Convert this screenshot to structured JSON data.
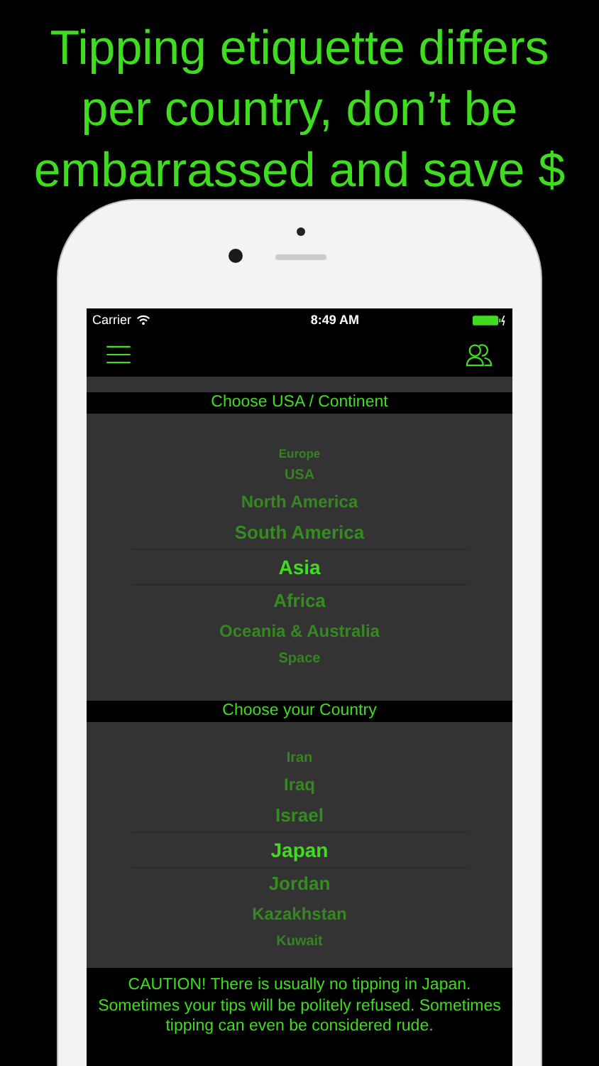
{
  "headline": "Tipping etiquette differs per country, don’t be embarrassed and save $",
  "status_bar": {
    "carrier": "Carrier",
    "time": "8:49 AM"
  },
  "continent_picker": {
    "title": "Choose USA / Continent",
    "items": [
      {
        "label": "Europe",
        "selected": false
      },
      {
        "label": "USA",
        "selected": false
      },
      {
        "label": "North America",
        "selected": false
      },
      {
        "label": "South America",
        "selected": false
      },
      {
        "label": "Asia",
        "selected": true
      },
      {
        "label": "Africa",
        "selected": false
      },
      {
        "label": "Oceania & Australia",
        "selected": false
      },
      {
        "label": "Space",
        "selected": false
      }
    ]
  },
  "country_picker": {
    "title": "Choose your Country",
    "items": [
      {
        "label": "Iran",
        "selected": false
      },
      {
        "label": "Iraq",
        "selected": false
      },
      {
        "label": "Israel",
        "selected": false
      },
      {
        "label": "Japan",
        "selected": true
      },
      {
        "label": "Jordan",
        "selected": false
      },
      {
        "label": "Kazakhstan",
        "selected": false
      },
      {
        "label": "Kuwait",
        "selected": false
      }
    ]
  },
  "caution": "CAUTION! There is usually no tipping in Japan. Sometimes your tips will be politely refused. Sometimes tipping can even be considered rude."
}
